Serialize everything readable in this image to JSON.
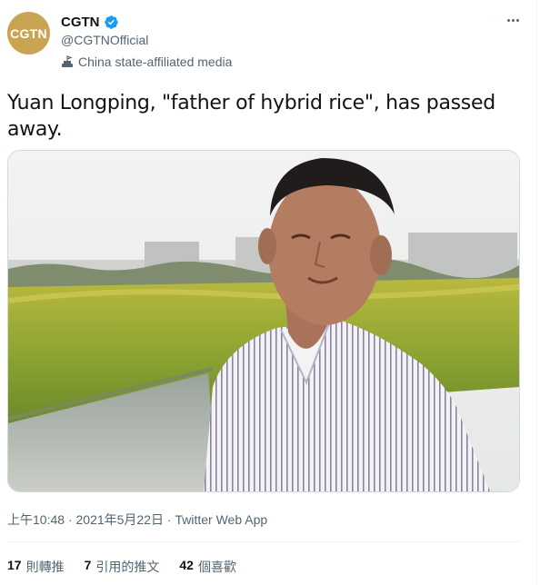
{
  "account": {
    "avatar_text": "CGTN",
    "display_name": "CGTN",
    "handle": "@CGTNOfficial",
    "affiliation": "China state-affiliated media",
    "avatar_color": "#c9a553",
    "verified_color": "#1d9bf0"
  },
  "tweet": {
    "text": "Yuan Longping, \"father of hybrid rice\", has passed away.",
    "time": "上午10:48",
    "separator": "·",
    "date": "2021年5月22日",
    "source": "Twitter Web App"
  },
  "stats": {
    "retweets": {
      "count": "17",
      "label": "則轉推"
    },
    "quotes": {
      "count": "7",
      "label": "引用的推文"
    },
    "likes": {
      "count": "42",
      "label": "個喜歡"
    }
  },
  "icons": {
    "verified": "verified-badge-icon",
    "affiliation": "state-media-flag-icon",
    "more": "more-options-icon"
  }
}
